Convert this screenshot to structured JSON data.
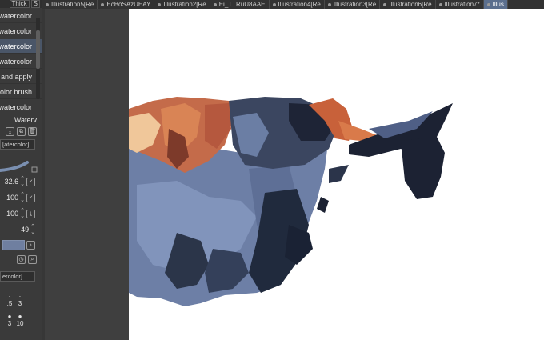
{
  "left_panel": {
    "top_label": "Thick",
    "top_label_suffix": "S",
    "brushes": [
      {
        "label": "watercolor",
        "selected": false
      },
      {
        "label": "watercolor",
        "selected": false
      },
      {
        "label": "watercolor",
        "selected": true
      },
      {
        "label": "watercolor",
        "selected": false
      },
      {
        "label": "and apply",
        "selected": false
      },
      {
        "label": "olor brush",
        "selected": false
      },
      {
        "label": "watercolor",
        "selected": false
      }
    ],
    "sub_tool_label": "Waterv",
    "tool_property_tag": "[atercolor]",
    "values": [
      "32.6",
      "100",
      "100",
      "49"
    ],
    "brush_size_tag": "ercolor]",
    "size_grid": [
      {
        "top": "·",
        "bottom": ".5"
      },
      {
        "top": "·",
        "bottom": "3"
      },
      {
        "top": "",
        "bottom": ""
      },
      {
        "top": "●",
        "bottom": "3"
      },
      {
        "top": "●",
        "bottom": "10"
      },
      {
        "top": "",
        "bottom": ""
      }
    ]
  },
  "tabs": [
    {
      "label": "Illustration5[Re",
      "active": false
    },
    {
      "label": "EcBoSAzUEAY",
      "active": false
    },
    {
      "label": "Illustration2[Re",
      "active": false
    },
    {
      "label": "Ei_TTRuU8AAE",
      "active": false
    },
    {
      "label": "Illustration4[Re",
      "active": false
    },
    {
      "label": "Illustration3[Re",
      "active": false
    },
    {
      "label": "Illustration6[Re",
      "active": false
    },
    {
      "label": "Illustration7*",
      "active": false
    },
    {
      "label": "Illus",
      "active": true
    }
  ],
  "colors": {
    "selected_row": "#4a5668",
    "active_tab": "#5b6f8e",
    "swatch": "#6f7fa0",
    "canvas_bg": "#ffffff"
  }
}
